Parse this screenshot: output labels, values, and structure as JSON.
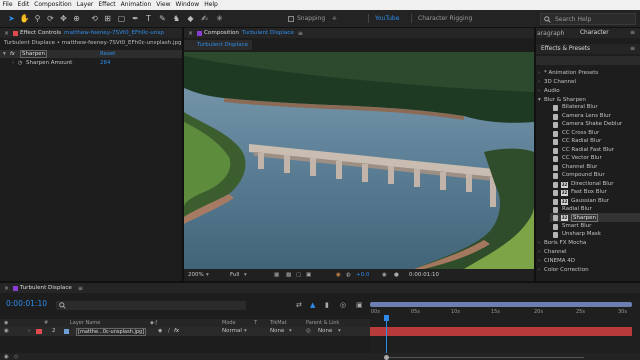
{
  "menu": [
    "File",
    "Edit",
    "Composition",
    "Layer",
    "Effect",
    "Animation",
    "View",
    "Window",
    "Help"
  ],
  "toolbar": {
    "snapping_label": "Snapping",
    "workspaces": [
      "YouTube",
      "Character Rigging"
    ],
    "search_placeholder": "Search Help"
  },
  "effect_controls": {
    "tab_title": "Effect Controls",
    "tab_file": "matthew-feeney-7SVt0_EFh0c-unsplash.jpg",
    "subtitle": "Turbulent Displace • matthew-feeney-7SVt0_EFh0c-unsplash.jpg",
    "fx_badge": "fx",
    "effect_name": "Sharpen",
    "reset_label": "Reset",
    "param_name": "Sharpen Amount",
    "param_value": "284"
  },
  "composition": {
    "tab_title": "Composition",
    "tab_name": "Turbulent Displace",
    "subtab": "Turbulent Displace",
    "zoom": "200%",
    "resolution": "Full",
    "exposure": "+0.0",
    "timecode": "0:00:01:10"
  },
  "right_panel": {
    "tab_left": "aragraph",
    "tab_right": "Character",
    "section_title": "Effects & Presets",
    "categories": [
      {
        "label": "* Animation Presets",
        "open": false
      },
      {
        "label": "3D Channel",
        "open": false
      },
      {
        "label": "Audio",
        "open": false
      },
      {
        "label": "Blur & Sharpen",
        "open": true
      }
    ],
    "blur_items": [
      {
        "label": "Bilateral Blur",
        "badge": ""
      },
      {
        "label": "Camera Lens Blur",
        "badge": ""
      },
      {
        "label": "Camera Shake Deblur",
        "badge": ""
      },
      {
        "label": "CC Cross Blur",
        "badge": ""
      },
      {
        "label": "CC Radial Blur",
        "badge": ""
      },
      {
        "label": "CC Radial Fast Blur",
        "badge": ""
      },
      {
        "label": "CC Vector Blur",
        "badge": ""
      },
      {
        "label": "Channel Blur",
        "badge": ""
      },
      {
        "label": "Compound Blur",
        "badge": ""
      },
      {
        "label": "Directional Blur",
        "badge": "32"
      },
      {
        "label": "Fast Box Blur",
        "badge": "32"
      },
      {
        "label": "Gaussian Blur",
        "badge": "32"
      },
      {
        "label": "Radial Blur",
        "badge": ""
      },
      {
        "label": "Sharpen",
        "badge": "32",
        "selected": true
      },
      {
        "label": "Smart Blur",
        "badge": ""
      },
      {
        "label": "Unsharp Mask",
        "badge": ""
      }
    ],
    "more_categories": [
      "Boris FX Mocha",
      "Channel",
      "CINEMA 4D",
      "Color Correction"
    ]
  },
  "timeline": {
    "tab_title": "Turbulent Displace",
    "timecode": "0:00:01:10",
    "col_layer_name": "Layer Name",
    "col_mode": "Mode",
    "col_t": "T",
    "col_trkmat": "TrkMat",
    "col_parent": "Parent & Link",
    "layer_number": "2",
    "layer_name": "[matthe...0c-unsplash.jpg]",
    "layer_mode": "Normal",
    "layer_trkmat": "None",
    "layer_parent": "None",
    "ruler_marks": [
      "00s",
      "05s",
      "10s",
      "15s",
      "20s",
      "25s",
      "30s"
    ]
  },
  "colors": {
    "accent": "#2d8ceb",
    "tab_square": "#8c3cd4",
    "layer_label": "#e0494d",
    "work_area": "#6c7fb0",
    "track": "#b83b3b"
  }
}
